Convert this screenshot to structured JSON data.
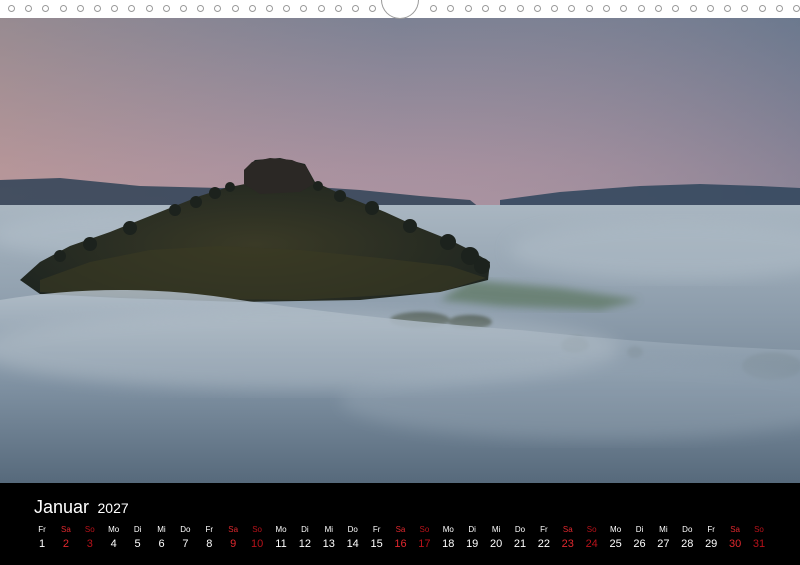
{
  "calendar": {
    "month": "Januar",
    "year": "2027",
    "days": [
      {
        "wd": "Fr",
        "num": "1",
        "type": "weekday"
      },
      {
        "wd": "Sa",
        "num": "2",
        "type": "sat"
      },
      {
        "wd": "So",
        "num": "3",
        "type": "sun"
      },
      {
        "wd": "Mo",
        "num": "4",
        "type": "weekday"
      },
      {
        "wd": "Di",
        "num": "5",
        "type": "weekday"
      },
      {
        "wd": "Mi",
        "num": "6",
        "type": "weekday"
      },
      {
        "wd": "Do",
        "num": "7",
        "type": "weekday"
      },
      {
        "wd": "Fr",
        "num": "8",
        "type": "weekday"
      },
      {
        "wd": "Sa",
        "num": "9",
        "type": "sat"
      },
      {
        "wd": "So",
        "num": "10",
        "type": "sun"
      },
      {
        "wd": "Mo",
        "num": "11",
        "type": "weekday"
      },
      {
        "wd": "Di",
        "num": "12",
        "type": "weekday"
      },
      {
        "wd": "Mi",
        "num": "13",
        "type": "weekday"
      },
      {
        "wd": "Do",
        "num": "14",
        "type": "weekday"
      },
      {
        "wd": "Fr",
        "num": "15",
        "type": "weekday"
      },
      {
        "wd": "Sa",
        "num": "16",
        "type": "sat"
      },
      {
        "wd": "So",
        "num": "17",
        "type": "sun"
      },
      {
        "wd": "Mo",
        "num": "18",
        "type": "weekday"
      },
      {
        "wd": "Di",
        "num": "19",
        "type": "weekday"
      },
      {
        "wd": "Mi",
        "num": "20",
        "type": "weekday"
      },
      {
        "wd": "Do",
        "num": "21",
        "type": "weekday"
      },
      {
        "wd": "Fr",
        "num": "22",
        "type": "weekday"
      },
      {
        "wd": "Sa",
        "num": "23",
        "type": "sat"
      },
      {
        "wd": "So",
        "num": "24",
        "type": "sun"
      },
      {
        "wd": "Mo",
        "num": "25",
        "type": "weekday"
      },
      {
        "wd": "Di",
        "num": "26",
        "type": "weekday"
      },
      {
        "wd": "Mi",
        "num": "27",
        "type": "weekday"
      },
      {
        "wd": "Do",
        "num": "28",
        "type": "weekday"
      },
      {
        "wd": "Fr",
        "num": "29",
        "type": "weekday"
      },
      {
        "wd": "Sa",
        "num": "30",
        "type": "sat"
      },
      {
        "wd": "So",
        "num": "31",
        "type": "sun"
      }
    ]
  },
  "colors": {
    "saturday": "#e0282e",
    "sunday": "#b8121a",
    "background_strip": "#000000",
    "text": "#ffffff"
  }
}
